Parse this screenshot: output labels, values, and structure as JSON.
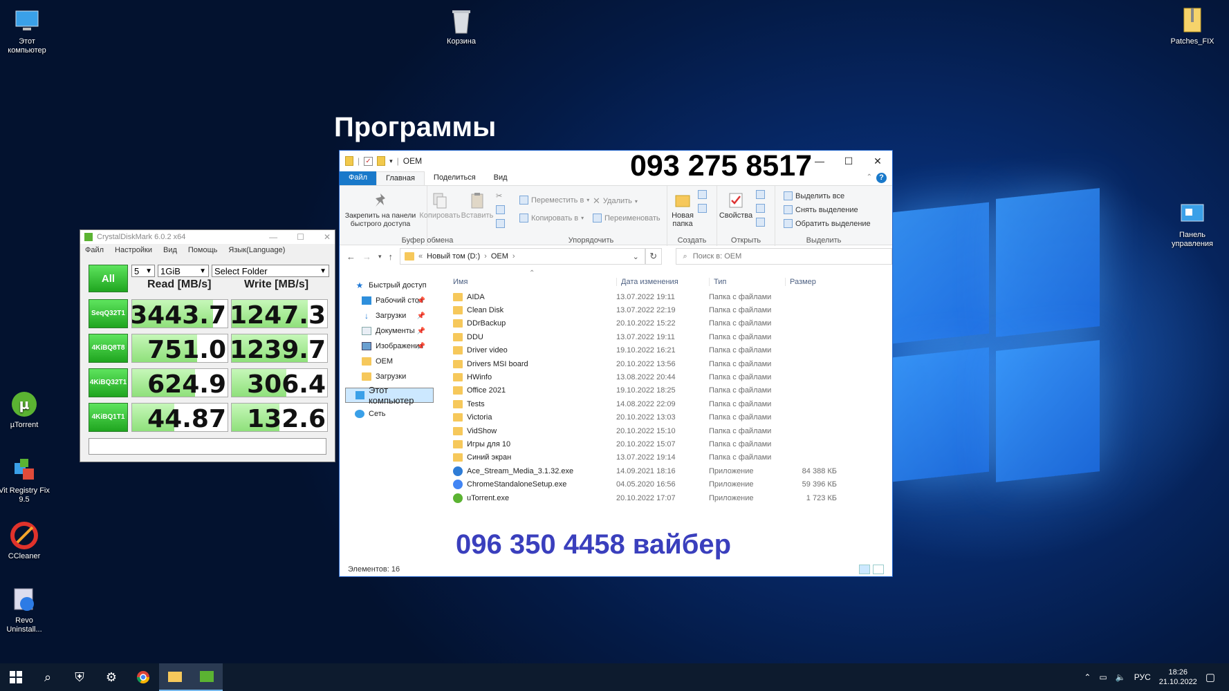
{
  "desktop": {
    "headline": "Программы",
    "icons": {
      "this_pc": "Этот компьютер",
      "recycle": "Корзина",
      "patches": "Patches_FIX",
      "control_panel": "Панель управления",
      "utorrent": "µTorrent",
      "vit": "Vit Registry Fix 9.5",
      "ccleaner": "CCleaner",
      "revo": "Revo Uninstall..."
    }
  },
  "cdm": {
    "title": "CrystalDiskMark 6.0.2 x64",
    "menu": [
      "Файл",
      "Настройки",
      "Вид",
      "Помощь",
      "Язык(Language)"
    ],
    "all_label": "All",
    "count": "5",
    "size": "1GiB",
    "folder": "Select Folder",
    "read_header": "Read [MB/s]",
    "write_header": "Write [MB/s]",
    "rows": [
      {
        "l1": "Seq",
        "l2": "Q32T1",
        "read": "3443.7",
        "write": "1247.3",
        "read_frac": 0.85,
        "write_frac": 0.8
      },
      {
        "l1": "4KiB",
        "l2": "Q8T8",
        "read": "751.0",
        "write": "1239.7",
        "read_frac": 0.68,
        "write_frac": 0.8
      },
      {
        "l1": "4KiB",
        "l2": "Q32T1",
        "read": "624.9",
        "write": "306.4",
        "read_frac": 0.66,
        "write_frac": 0.57
      },
      {
        "l1": "4KiB",
        "l2": "Q1T1",
        "read": "44.87",
        "write": "132.6",
        "read_frac": 0.44,
        "write_frac": 0.5
      }
    ]
  },
  "explorer": {
    "title": "OEM",
    "phone_top": "093 275 8517",
    "phone_bottom": "096 350 4458  вайбер",
    "tabs": [
      "Файл",
      "Главная",
      "Поделиться",
      "Вид"
    ],
    "ribbon": {
      "pin": "Закрепить на панели быстрого доступа",
      "copy": "Копировать",
      "paste": "Вставить",
      "clipboard": "Буфер обмена",
      "move_to": "Переместить в",
      "copy_to": "Копировать в",
      "delete": "Удалить",
      "rename": "Переименовать",
      "organize": "Упорядочить",
      "new_folder": "Новая папка",
      "create": "Создать",
      "properties": "Свойства",
      "open": "Открыть",
      "select_all": "Выделить все",
      "select_none": "Снять выделение",
      "invert": "Обратить выделение",
      "select": "Выделить"
    },
    "address": {
      "drive": "Новый том (D:)",
      "folder": "OEM",
      "search_placeholder": "Поиск в: OEM"
    },
    "nav": [
      {
        "label": "Быстрый доступ",
        "icon": "star",
        "pin": false,
        "indent": 14
      },
      {
        "label": "Рабочий стол",
        "icon": "desk",
        "pin": true,
        "indent": 24
      },
      {
        "label": "Загрузки",
        "icon": "down",
        "pin": true,
        "indent": 24
      },
      {
        "label": "Документы",
        "icon": "doc",
        "pin": true,
        "indent": 24
      },
      {
        "label": "Изображения",
        "icon": "img",
        "pin": true,
        "indent": 24
      },
      {
        "label": "OEM",
        "icon": "folder",
        "pin": false,
        "indent": 24
      },
      {
        "label": "Загрузки",
        "icon": "folder",
        "pin": false,
        "indent": 24
      },
      {
        "label": "Этот компьютер",
        "icon": "pc",
        "pin": false,
        "indent": 14,
        "selected": true
      },
      {
        "label": "Сеть",
        "icon": "net",
        "pin": false,
        "indent": 14
      }
    ],
    "columns": {
      "name": "Имя",
      "date": "Дата изменения",
      "type": "Тип",
      "size": "Размер"
    },
    "files": [
      {
        "name": "AIDA",
        "date": "13.07.2022 19:11",
        "type": "Папка с файлами",
        "size": "",
        "kind": "folder"
      },
      {
        "name": "Clean Disk",
        "date": "13.07.2022 22:19",
        "type": "Папка с файлами",
        "size": "",
        "kind": "folder"
      },
      {
        "name": "DDrBackup",
        "date": "20.10.2022 15:22",
        "type": "Папка с файлами",
        "size": "",
        "kind": "folder"
      },
      {
        "name": "DDU",
        "date": "13.07.2022 19:11",
        "type": "Папка с файлами",
        "size": "",
        "kind": "folder"
      },
      {
        "name": "Driver video",
        "date": "19.10.2022 16:21",
        "type": "Папка с файлами",
        "size": "",
        "kind": "folder"
      },
      {
        "name": "Drivers MSI board",
        "date": "20.10.2022 13:56",
        "type": "Папка с файлами",
        "size": "",
        "kind": "folder"
      },
      {
        "name": "HWinfo",
        "date": "13.08.2022 20:44",
        "type": "Папка с файлами",
        "size": "",
        "kind": "folder"
      },
      {
        "name": "Office 2021",
        "date": "19.10.2022 18:25",
        "type": "Папка с файлами",
        "size": "",
        "kind": "folder"
      },
      {
        "name": "Tests",
        "date": "14.08.2022 22:09",
        "type": "Папка с файлами",
        "size": "",
        "kind": "folder"
      },
      {
        "name": "Victoria",
        "date": "20.10.2022 13:03",
        "type": "Папка с файлами",
        "size": "",
        "kind": "folder"
      },
      {
        "name": "VidShow",
        "date": "20.10.2022 15:10",
        "type": "Папка с файлами",
        "size": "",
        "kind": "folder"
      },
      {
        "name": "Игры  для 10",
        "date": "20.10.2022 15:07",
        "type": "Папка с файлами",
        "size": "",
        "kind": "folder"
      },
      {
        "name": "Синий экран",
        "date": "13.07.2022 19:14",
        "type": "Папка с файлами",
        "size": "",
        "kind": "folder"
      },
      {
        "name": "Ace_Stream_Media_3.1.32.exe",
        "date": "14.09.2021 18:16",
        "type": "Приложение",
        "size": "84 388 КБ",
        "kind": "ace"
      },
      {
        "name": "ChromeStandaloneSetup.exe",
        "date": "04.05.2020 16:56",
        "type": "Приложение",
        "size": "59 396 КБ",
        "kind": "chrome"
      },
      {
        "name": "uTorrent.exe",
        "date": "20.10.2022 17:07",
        "type": "Приложение",
        "size": "1 723 КБ",
        "kind": "utorrent"
      }
    ],
    "status": "Элементов: 16"
  },
  "taskbar": {
    "lang": "РУС",
    "time": "18:26",
    "date": "21.10.2022"
  },
  "colors": {
    "accent": "#1979ca",
    "cdm_green": "#1fa51f",
    "phone_blue": "#3a3fbd"
  }
}
